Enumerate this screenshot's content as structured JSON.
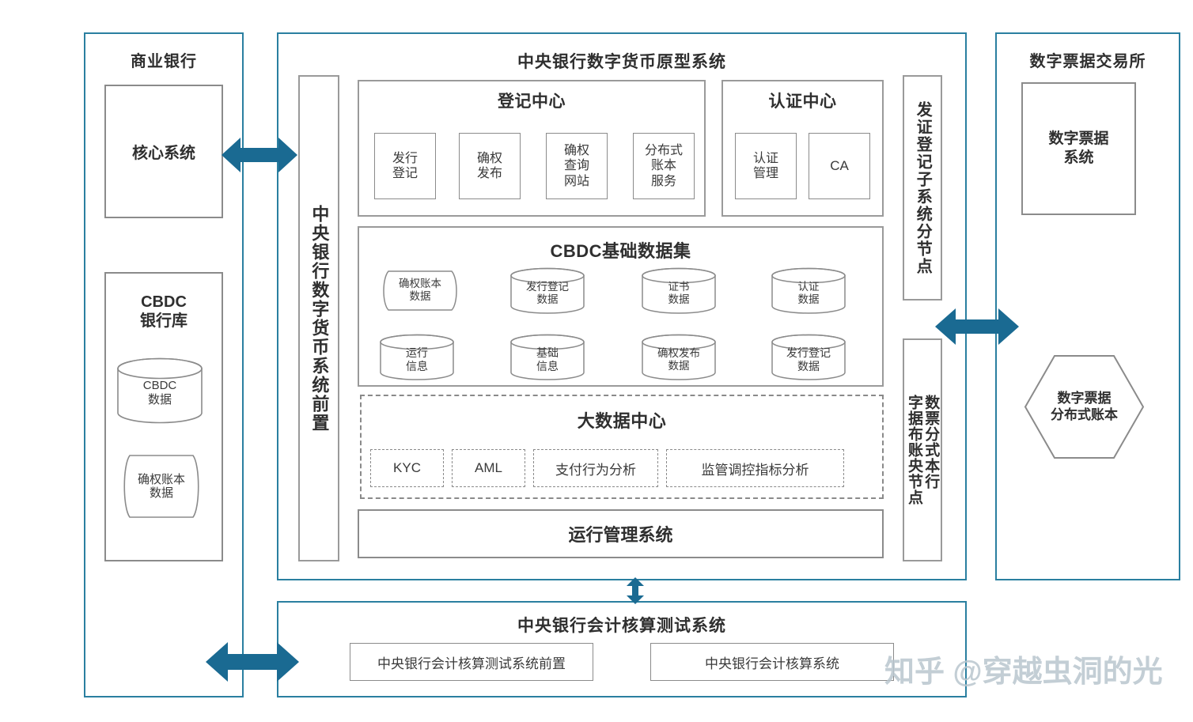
{
  "diagram": {
    "type": "architecture-block-diagram",
    "accent_color": "#2a7fa0",
    "box_border_color": "#8b8b8b",
    "arrow_color": "#1a6a92",
    "background": "#ffffff"
  },
  "commercial_bank_panel": {
    "title": "商业银行",
    "core_system": "核心系统",
    "cbdc_vault": {
      "title_line1": "CBDC",
      "title_line2": "银行库",
      "cbdc_data": {
        "line1": "CBDC",
        "line2": "数据"
      },
      "ledger_data": {
        "line1": "确权账本",
        "line2": "数据"
      }
    }
  },
  "central_panel": {
    "title": "中央银行数字货币原型系统",
    "frontend_label": "中央银行数字货币系统前置",
    "registration_center": {
      "title": "登记中心",
      "items": [
        {
          "line1": "发行",
          "line2": "登记",
          "line3": ""
        },
        {
          "line1": "确权",
          "line2": "发布",
          "line3": ""
        },
        {
          "line1": "确权",
          "line2": "查询",
          "line3": "网站"
        },
        {
          "line1": "分布式",
          "line2": "账本",
          "line3": "服务"
        }
      ]
    },
    "authentication_center": {
      "title": "认证中心",
      "items": [
        {
          "line1": "认证",
          "line2": "管理"
        },
        {
          "line1": "CA",
          "line2": ""
        }
      ]
    },
    "issuing_node_label": "发证登记子系统分节点",
    "bill_ledger_node_label_col1": "数票分式本行",
    "bill_ledger_node_label_col2": "字据布账央节点",
    "cbdc_dataset": {
      "title": "CBDC基础数据集",
      "row1": [
        {
          "shape": "tape",
          "line1": "确权账本",
          "line2": "数据"
        },
        {
          "shape": "cylinder",
          "line1": "发行登记",
          "line2": "数据"
        },
        {
          "shape": "cylinder",
          "line1": "证书",
          "line2": "数据"
        },
        {
          "shape": "cylinder",
          "line1": "认证",
          "line2": "数据"
        }
      ],
      "row2": [
        {
          "shape": "cylinder",
          "line1": "运行",
          "line2": "信息"
        },
        {
          "shape": "cylinder",
          "line1": "基础",
          "line2": "信息"
        },
        {
          "shape": "cylinder",
          "line1": "确权发布",
          "line2": "数据"
        },
        {
          "shape": "cylinder",
          "line1": "发行登记",
          "line2": "数据"
        }
      ]
    },
    "big_data_center": {
      "title": "大数据中心",
      "items": [
        "KYC",
        "AML",
        "支付行为分析",
        "监管调控指标分析"
      ]
    },
    "operation_management_system": "运行管理系统"
  },
  "digital_bill_exchange_panel": {
    "title": "数字票据交易所",
    "bill_system": {
      "line1": "数字票据",
      "line2": "系统"
    },
    "distributed_ledger": {
      "line1": "数字票据",
      "line2": "分布式账本"
    }
  },
  "accounting_panel": {
    "title": "中央银行会计核算测试系统",
    "items": [
      "中央银行会计核算测试系统前置",
      "中央银行会计核算系统"
    ]
  },
  "arrows": [
    {
      "name": "bank-to-central",
      "direction": "bidirectional-horizontal"
    },
    {
      "name": "central-to-exchange",
      "direction": "bidirectional-horizontal"
    },
    {
      "name": "central-to-accounting",
      "direction": "bidirectional-vertical"
    },
    {
      "name": "bank-to-accounting",
      "direction": "bidirectional-horizontal"
    }
  ],
  "watermark": {
    "text": "知乎 @穿越虫洞的光"
  }
}
